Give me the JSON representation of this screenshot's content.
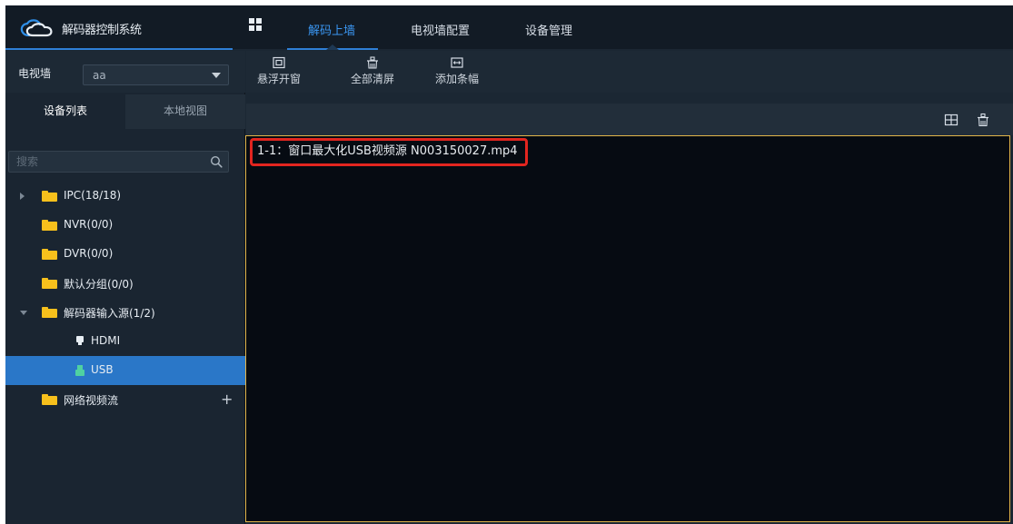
{
  "app": {
    "title": "解码器控制系统"
  },
  "nav": {
    "items": [
      {
        "label": "解码上墙",
        "active": true
      },
      {
        "label": "电视墙配置",
        "active": false
      },
      {
        "label": "设备管理",
        "active": false
      }
    ]
  },
  "left": {
    "wall_label": "电视墙",
    "wall_value": "aa",
    "tabs": [
      "设备列表",
      "本地视图"
    ],
    "search_placeholder": "搜索",
    "tree": [
      {
        "label": "IPC(18/18)",
        "expand": "collapsed",
        "icon": "folder-icon"
      },
      {
        "label": "NVR(0/0)",
        "expand": "none",
        "icon": "folder-icon"
      },
      {
        "label": "DVR(0/0)",
        "expand": "none",
        "icon": "folder-icon"
      },
      {
        "label": "默认分组(0/0)",
        "expand": "none",
        "icon": "folder-icon"
      },
      {
        "label": "解码器输入源(1/2)",
        "expand": "expanded",
        "icon": "folder-icon"
      },
      {
        "label": "HDMI",
        "child": true,
        "icon": "hdmi-icon"
      },
      {
        "label": "USB",
        "child": true,
        "icon": "usb-icon",
        "selected": true
      },
      {
        "label": "网络视频流",
        "expand": "none",
        "icon": "folder-icon",
        "action": "add"
      }
    ]
  },
  "toolbar": {
    "float_window": "悬浮开窗",
    "clear_all": "全部清屏",
    "add_banner": "添加条幅"
  },
  "screen": {
    "window_title": "1-1：窗口最大化USB视频源 N003150027.mp4"
  },
  "colors": {
    "accent": "#2f7fd6",
    "active_nav": "#3a95f0",
    "selection": "#2a77c8",
    "folder": "#f7c01c",
    "screen_border": "#e2b54a",
    "highlight_box": "#e2251f"
  }
}
